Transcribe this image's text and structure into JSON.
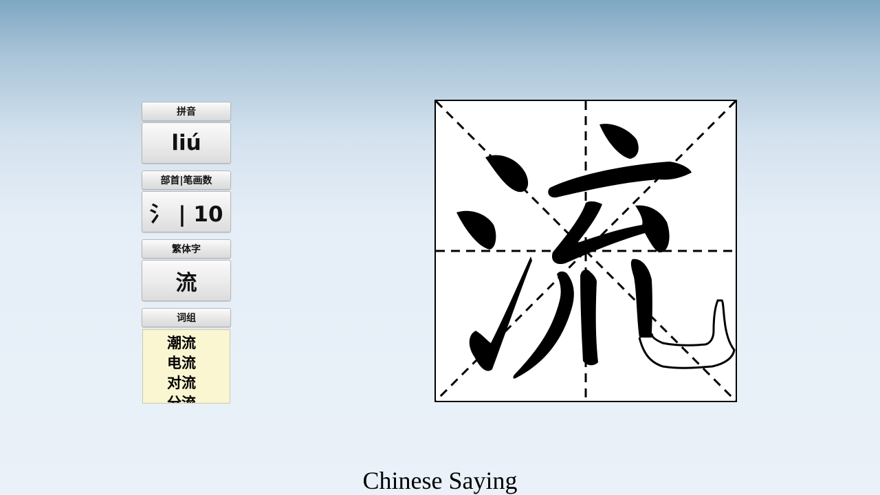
{
  "pinyin": {
    "label": "拼音",
    "value": "liú"
  },
  "radical_strokes": {
    "label": "部首|笔画数",
    "value": "氵 | 10"
  },
  "traditional": {
    "label": "繁体字",
    "value": "流"
  },
  "words": {
    "label": "词组",
    "items": [
      "潮流",
      "电流",
      "对流",
      "分流"
    ]
  },
  "character_display": {
    "character": "流"
  },
  "caption": "Chinese Saying"
}
